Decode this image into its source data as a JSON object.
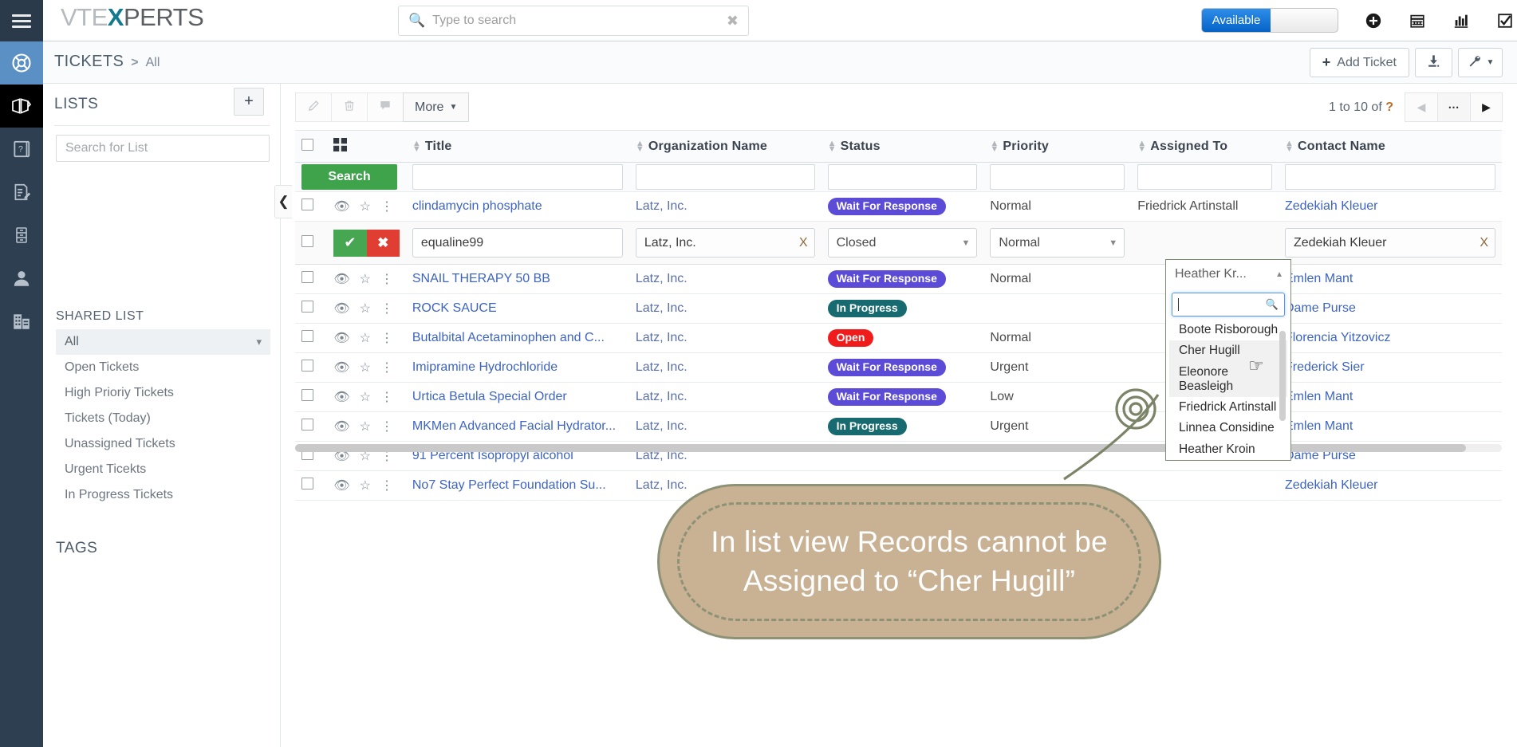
{
  "brand": {
    "name_parts": [
      "VTE",
      "X",
      "PERTS"
    ],
    "accent": "#12798f"
  },
  "topbar": {
    "search_placeholder": "Type to search",
    "search_value": "",
    "status_label": "Available",
    "icons": [
      "plus-circle-icon",
      "calendar-icon",
      "analytics-icon",
      "tasks-icon",
      "user-icon"
    ]
  },
  "breadcrumb": {
    "module": "TICKETS",
    "separator": ">",
    "view": "All"
  },
  "header_actions": {
    "add_label": "Add Ticket",
    "import_icon": "import-icon",
    "settings_icon": "wrench-icon"
  },
  "lists_panel": {
    "title": "LISTS",
    "add_label": "+",
    "search_placeholder": "Search for List",
    "search_value": "",
    "shared_label": "SHARED LIST",
    "items": [
      {
        "label": "All",
        "selected": true
      },
      {
        "label": "Open Tickets",
        "selected": false
      },
      {
        "label": "High Prioriy Tickets",
        "selected": false
      },
      {
        "label": "Tickets (Today)",
        "selected": false
      },
      {
        "label": "Unassigned Tickets",
        "selected": false
      },
      {
        "label": "Urgent Ticekts",
        "selected": false
      },
      {
        "label": "In Progress Tickets",
        "selected": false
      }
    ],
    "tags_label": "TAGS"
  },
  "list_toolbar": {
    "edit_icon": "pencil-icon",
    "delete_icon": "trash-icon",
    "comment_icon": "comment-icon",
    "more_label": "More"
  },
  "pagination": {
    "range_text": "1 to 10",
    "of_text": "of",
    "total": "?",
    "prev_icon": "prev-arrow-icon",
    "dots_icon": "ellipsis-icon",
    "next_icon": "next-arrow-icon"
  },
  "table": {
    "search_button": "Search",
    "columns": [
      "Title",
      "Organization Name",
      "Status",
      "Priority",
      "Assigned To",
      "Contact Name"
    ],
    "filters": {
      "title": "",
      "organization": "",
      "status": "",
      "priority": "",
      "assigned": "",
      "contact": ""
    },
    "rows": [
      {
        "title": "clindamycin phosphate",
        "organization": "Latz, Inc.",
        "status": "Wait For Response",
        "status_color": "#5B4BD6",
        "priority": "Normal",
        "assigned": "Friedrick Artinstall",
        "contact": "Zedekiah Kleuer"
      },
      {
        "title": "SNAIL THERAPY 50 BB",
        "organization": "Latz, Inc.",
        "status": "Wait For Response",
        "status_color": "#5B4BD6",
        "priority": "Normal",
        "assigned": "",
        "contact": "Emlen Mant"
      },
      {
        "title": "ROCK SAUCE",
        "organization": "Latz, Inc.",
        "status": "In Progress",
        "status_color": "#176A6F",
        "priority": "",
        "assigned": "",
        "contact": "Dame Purse"
      },
      {
        "title": "Butalbital Acetaminophen and C...",
        "organization": "Latz, Inc.",
        "status": "Open",
        "status_color": "#F01C1C",
        "priority": "Normal",
        "assigned": "",
        "contact": "Florencia Yitzovicz"
      },
      {
        "title": "Imipramine Hydrochloride",
        "organization": "Latz, Inc.",
        "status": "Wait For Response",
        "status_color": "#5B4BD6",
        "priority": "Urgent",
        "assigned": "",
        "contact": "Frederick Sier"
      },
      {
        "title": "Urtica Betula Special Order",
        "organization": "Latz, Inc.",
        "status": "Wait For Response",
        "status_color": "#5B4BD6",
        "priority": "Low",
        "assigned": "",
        "contact": "Emlen Mant"
      },
      {
        "title": "MKMen Advanced Facial Hydrator...",
        "organization": "Latz, Inc.",
        "status": "In Progress",
        "status_color": "#176A6F",
        "priority": "Urgent",
        "assigned": "",
        "contact": "Emlen Mant"
      },
      {
        "title": "91 Percent Isopropyl alcohol",
        "organization": "Latz, Inc.",
        "status": "",
        "status_color": "",
        "priority": "",
        "assigned": "",
        "contact": "Dame Purse"
      },
      {
        "title": "No7 Stay Perfect Foundation Su...",
        "organization": "Latz, Inc.",
        "status": "",
        "status_color": "",
        "priority": "",
        "assigned": "",
        "contact": "Zedekiah Kleuer"
      }
    ],
    "edit_row": {
      "confirm_icon": "check-icon",
      "cancel_icon": "x-icon",
      "title_value": "equaline99",
      "organization_value": "Latz, Inc.",
      "organization_clear": "X",
      "status_value": "Closed",
      "priority_value": "Normal",
      "assigned_value": "Heather Kr...",
      "contact_value": "Zedekiah Kleuer",
      "contact_clear": "X"
    }
  },
  "assigned_dropdown": {
    "selected_label": "Heather Kr...",
    "search_value": "",
    "search_icon": "magnifier-icon",
    "options": [
      {
        "label": "Boote Risborough",
        "highlighted": false
      },
      {
        "label": "Cher Hugill",
        "highlighted": true
      },
      {
        "label": "Eleonore Beasleigh",
        "highlighted": true
      },
      {
        "label": "Friedrick Artinstall",
        "highlighted": false
      },
      {
        "label": "Linnea Considine",
        "highlighted": false
      },
      {
        "label": "Heather Kroin",
        "highlighted": false
      }
    ]
  },
  "callout": {
    "text": "In list view Records cannot be Assigned to “Cher Hugill”",
    "fill": "#c9b194",
    "stroke": "#8d9276"
  },
  "sidebar_rail": {
    "hamburger": "hamburger-icon",
    "items": [
      {
        "name": "support-icon",
        "state": "selected"
      },
      {
        "name": "tickets-icon",
        "state": "active"
      },
      {
        "name": "knowledgebase-icon",
        "state": ""
      },
      {
        "name": "documents-icon",
        "state": ""
      },
      {
        "name": "archive-icon",
        "state": ""
      },
      {
        "name": "contacts-icon",
        "state": ""
      },
      {
        "name": "organizations-icon",
        "state": ""
      }
    ]
  }
}
